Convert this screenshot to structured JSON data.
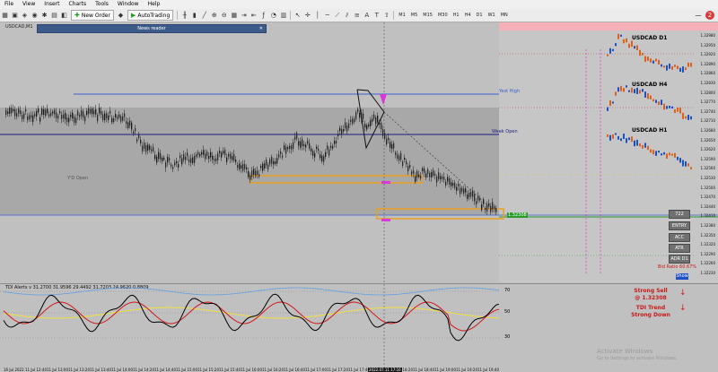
{
  "menu": [
    "File",
    "View",
    "Insert",
    "Charts",
    "Tools",
    "Window",
    "Help"
  ],
  "toolbar": {
    "new_order": "New Order",
    "autotrading": "AutoTrading",
    "timeframes": [
      "M1",
      "M5",
      "M15",
      "M30",
      "H1",
      "H4",
      "D1",
      "W1",
      "MN"
    ]
  },
  "news_reader": "News reader",
  "symbol": "USDCAD,M1",
  "labels": {
    "yest_high": "Yest High",
    "week_open": "Week Open",
    "yd_open": "Y'D Open"
  },
  "mini_charts": [
    "USDCAD D1",
    "USDCAD H4",
    "USDCAD H1"
  ],
  "side_buttons": [
    "722",
    "ENTRY",
    "ACC",
    "ATR",
    "ADR D1"
  ],
  "bid_ratio": "Bid Ratio 60.67%",
  "show_button": "Show",
  "signals": {
    "signal": "Strong Sell",
    "price": "@ 1.32308",
    "tdi_trend": "TDI Trend",
    "tdi_state": "Strong Down"
  },
  "indicator_title": "TDI Alerts v 31.2700 31.9596 29.4492 31.7203 24.9620 0.8809",
  "indicator_levels": [
    "70",
    "50",
    "30"
  ],
  "time_labels": [
    "16 Jul 2022",
    "11 Jul 12:40",
    "11 Jul 13:00",
    "11 Jul 13:20",
    "11 Jul 13:40",
    "11 Jul 14:00",
    "11 Jul 14:20",
    "11 Jul 14:40",
    "11 Jul 15:00",
    "11 Jul 15:20",
    "11 Jul 15:40",
    "11 Jul 16:00",
    "11 Jul 16:20",
    "11 Jul 16:40",
    "11 Jul 17:00",
    "11 Jul 17:20",
    "11 Jul 17:40",
    "11 Jul 18:00",
    "11 Jul 18:20",
    "11 Jul 18:40",
    "11 Jul 19:00",
    "11 Jul 19:20",
    "11 Jul 19:40"
  ],
  "time_selected": "2022.07.11 17:16",
  "yaxis_main": [
    "1.32980",
    "1.32950",
    "1.32920",
    "1.32890",
    "1.32860",
    "1.32830",
    "1.32800",
    "1.32770",
    "1.32740",
    "1.32710",
    "1.32680",
    "1.32650",
    "1.32620",
    "1.32590",
    "1.32560",
    "1.32530",
    "1.32500",
    "1.32470",
    "1.32440",
    "1.32410",
    "1.32380",
    "1.32350",
    "1.32320",
    "1.32290",
    "1.32260",
    "1.32230"
  ],
  "price_tag": "1.32308",
  "colors": {
    "bg": "#c0c0c0",
    "candle": "#1a1a1a",
    "blue_line": "#3a5fd0",
    "navy_line": "#1a1a80",
    "green_line": "#2a9a2a",
    "orange_box": "#e8a020",
    "magenta": "#d838d8",
    "tdi_black": "#000000",
    "tdi_red": "#d01818",
    "tdi_yellow": "#f0e040",
    "tdi_blue": "#60a0e0"
  },
  "watermark": [
    "Activate Windows",
    "Go to Settings to activate Windows."
  ],
  "window_controls": [
    "minimize",
    "restore",
    "close-or-notif"
  ],
  "notif_count": "2"
}
